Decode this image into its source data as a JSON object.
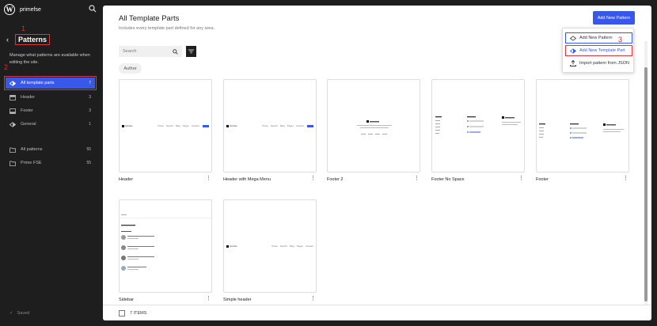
{
  "site": {
    "name": "primefse",
    "logo": "wordpress-logo"
  },
  "sidebar": {
    "title": "Patterns",
    "description": "Manage what patterns are available when editing the site.",
    "items": [
      {
        "label": "All template parts",
        "count": "7",
        "icon": "template-parts-icon",
        "active": true
      },
      {
        "label": "Header",
        "count": "3",
        "icon": "header-icon"
      },
      {
        "label": "Footer",
        "count": "3",
        "icon": "footer-icon"
      },
      {
        "label": "General",
        "count": "1",
        "icon": "symbol-icon"
      },
      {
        "label": "All patterns",
        "count": "55",
        "icon": "folder-icon"
      },
      {
        "label": "Prime FSE",
        "count": "55",
        "icon": "folder-icon"
      }
    ],
    "status": "Saved"
  },
  "annotations": {
    "one": "1",
    "two": "2",
    "three": "3"
  },
  "colors": {
    "accent": "#3858e9",
    "annotation": "#d9363e",
    "dark_bg": "#1e1e1e"
  },
  "main": {
    "title": "All Template Parts",
    "subtitle": "Includes every template part defined for any area.",
    "add_button": "Add New Pattern",
    "search_placeholder": "Search",
    "filter_chip": "Author",
    "items_count": "7 ITEMS",
    "cards": [
      {
        "name": "Header"
      },
      {
        "name": "Header with Mega Menu"
      },
      {
        "name": "Footer 2"
      },
      {
        "name": "Footer No Space"
      },
      {
        "name": "Footer"
      },
      {
        "name": "Sidebar"
      },
      {
        "name": "Simple header"
      }
    ]
  },
  "dropdown": {
    "items": [
      {
        "label": "Add New Pattern",
        "icon": "symbol-icon"
      },
      {
        "label": "Add New Template Part",
        "icon": "template-parts-icon"
      },
      {
        "label": "Import pattern from JSON",
        "icon": "upload-icon"
      }
    ]
  }
}
